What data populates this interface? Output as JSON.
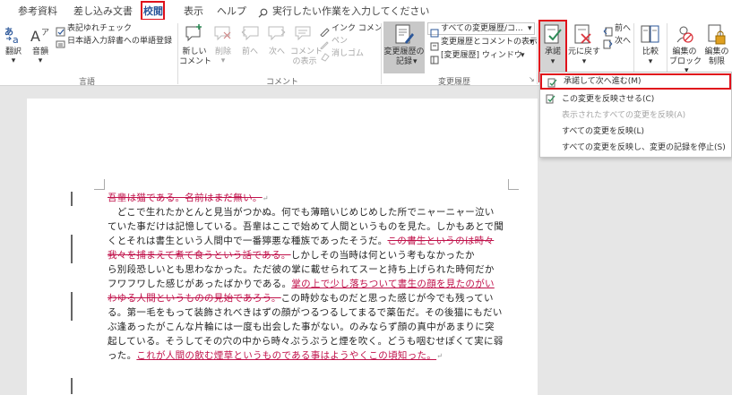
{
  "tabs": [
    {
      "label": "参考資料",
      "active": false
    },
    {
      "label": "差し込み文書",
      "active": false
    },
    {
      "label": "校閲",
      "active": true
    },
    {
      "label": "表示",
      "active": false
    },
    {
      "label": "ヘルプ",
      "active": false
    }
  ],
  "search": {
    "label": "実行したい作業を入力してください",
    "icon": "search-icon"
  },
  "ribbon": {
    "language_group": {
      "label": "言語",
      "translate": "翻訳",
      "translate_arrow": "▾",
      "pitch": "音韻",
      "pitch_arrow": "▾",
      "notation_check": "表記ゆれチェック",
      "dictionary": "日本語入力辞書への単語登録"
    },
    "comment_group": {
      "label": "コメント",
      "new_comment": [
        "新しい",
        "コメント"
      ],
      "delete": "削除",
      "delete_arrow": "▾",
      "previous": "前へ",
      "next": "次へ",
      "show_comments": [
        "コメント",
        "の表示"
      ],
      "ink_comment": "インク コメント",
      "pen": "ペン",
      "eraser": "消しゴム"
    },
    "tracking_group": {
      "label": "変更履歴",
      "track_changes": [
        "変更履歴の",
        "記録"
      ],
      "track_changes_arrow": "▾",
      "markup_select": "すべての変更履歴/コ...",
      "show_markup": "変更履歴とコメントの表示",
      "show_markup_arrow": "▾",
      "reviewing_pane": "[変更履歴] ウィンドウ",
      "reviewing_pane_arrow": "▾",
      "launcher": "↘"
    },
    "changes_group": {
      "accept": "承諾",
      "accept_arrow": "▾",
      "reject": "元に戻す",
      "reject_arrow": "▾",
      "previous": "前へ",
      "next": "次へ"
    },
    "compare": {
      "label": "比較",
      "arrow": "▾"
    },
    "protect": {
      "block_authors": [
        "編集の",
        "ブロック"
      ],
      "block_authors_arrow": "▾",
      "restrict_editing": [
        "編集の",
        "制限"
      ]
    }
  },
  "accept_menu": {
    "items": [
      {
        "label": "承諾して次へ進む(M)",
        "disabled": false,
        "highlight": true
      },
      {
        "label": "この変更を反映させる(C)",
        "disabled": false,
        "highlight": false
      },
      {
        "label": "表示されたすべての変更を反映(A)",
        "disabled": true,
        "highlight": false
      },
      {
        "label": "すべての変更を反映(L)",
        "disabled": false,
        "highlight": false
      },
      {
        "label": "すべての変更を反映し、変更の記録を停止(S)",
        "disabled": false,
        "highlight": false
      }
    ]
  },
  "document": {
    "lines": [
      {
        "segments": [
          {
            "text": "吾輩は猫である。名前はまだ無い。",
            "style": "del"
          },
          {
            "text": "↵",
            "style": "mark"
          }
        ]
      },
      {
        "segments": [
          {
            "text": "　どこで生れたかとんと見当がつかぬ。何でも薄暗いじめじめした所でニャーニャー泣い",
            "style": "normal"
          }
        ]
      },
      {
        "segments": [
          {
            "text": "ていた事だけは記憶している。吾輩はここで始めて人間というものを見た。しかもあとで聞",
            "style": "normal"
          }
        ]
      },
      {
        "segments": [
          {
            "text": "くとそれは書生という人間中で一番獰悪な種族であったそうだ。",
            "style": "normal"
          },
          {
            "text": "この書生というのは時々",
            "style": "del"
          }
        ]
      },
      {
        "segments": [
          {
            "text": "我々を捕まえて煮て食うという話である。",
            "style": "del"
          },
          {
            "text": "しかしその当時は何という考もなかったか",
            "style": "normal"
          }
        ]
      },
      {
        "segments": [
          {
            "text": "ら別段恐しいとも思わなかった。ただ彼の掌に載せられてスーと持ち上げられた時何だか",
            "style": "normal"
          }
        ]
      },
      {
        "segments": [
          {
            "text": "フワフワした感じがあったばかりである。",
            "style": "normal"
          },
          {
            "text": "掌の上で少し落ちついて書生の顔を見たのがい",
            "style": "ins"
          }
        ]
      },
      {
        "segments": [
          {
            "text": "わゆる人間というものの見始であろう。",
            "style": "del"
          },
          {
            "text": "この時妙なものだと思った感じが今でも残ってい",
            "style": "normal"
          }
        ]
      },
      {
        "segments": [
          {
            "text": "る。第一毛をもって装飾されべきはずの顔がつるつるしてまるで薬缶だ。その後猫にもだい",
            "style": "normal"
          }
        ]
      },
      {
        "segments": [
          {
            "text": "ぶ逢あったがこんな片輪には一度も出会した事がない。のみならず顔の真中があまりに突",
            "style": "normal"
          }
        ]
      },
      {
        "segments": [
          {
            "text": "起している。そうしてその穴の中から時々ぷうぷうと煙を吹く。どうも咽むせぽくて実に弱",
            "style": "normal"
          }
        ]
      },
      {
        "segments": [
          {
            "text": "った。",
            "style": "normal"
          },
          {
            "text": "これが人間の飲む煙草というものである事はようやくこの頃知った。",
            "style": "ins"
          },
          {
            "text": "↵",
            "style": "mark"
          }
        ]
      }
    ]
  },
  "colors": {
    "accent": "#2b579a",
    "highlight_border": "#e0111b",
    "revision": "#c0114a"
  }
}
